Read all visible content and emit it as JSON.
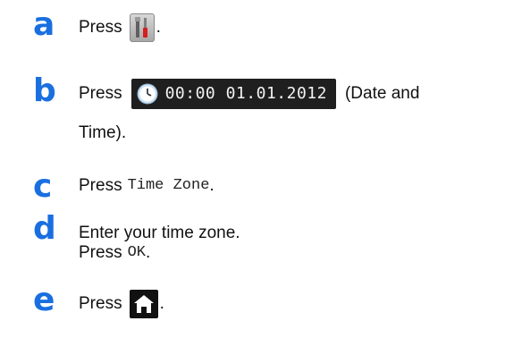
{
  "steps": [
    {
      "letter": "a",
      "press": "Press",
      "after": "."
    },
    {
      "letter": "b",
      "press": "Press",
      "datetime": "00:00 01.01.2012",
      "after": "(Date and",
      "cont": "Time)."
    },
    {
      "letter": "c",
      "press": "Press",
      "mono": "Time Zone",
      "after": "."
    },
    {
      "letter": "d",
      "line1": "Enter your time zone.",
      "press": "Press",
      "mono": "OK",
      "after": "."
    },
    {
      "letter": "e",
      "press": "Press",
      "after": "."
    }
  ],
  "icons": {
    "tools": "settings-tools-icon",
    "clock": "clock-icon",
    "home": "home-icon"
  },
  "colors": {
    "step_letter": "#1a6fe0",
    "button_dark": "#1f1f1f"
  }
}
